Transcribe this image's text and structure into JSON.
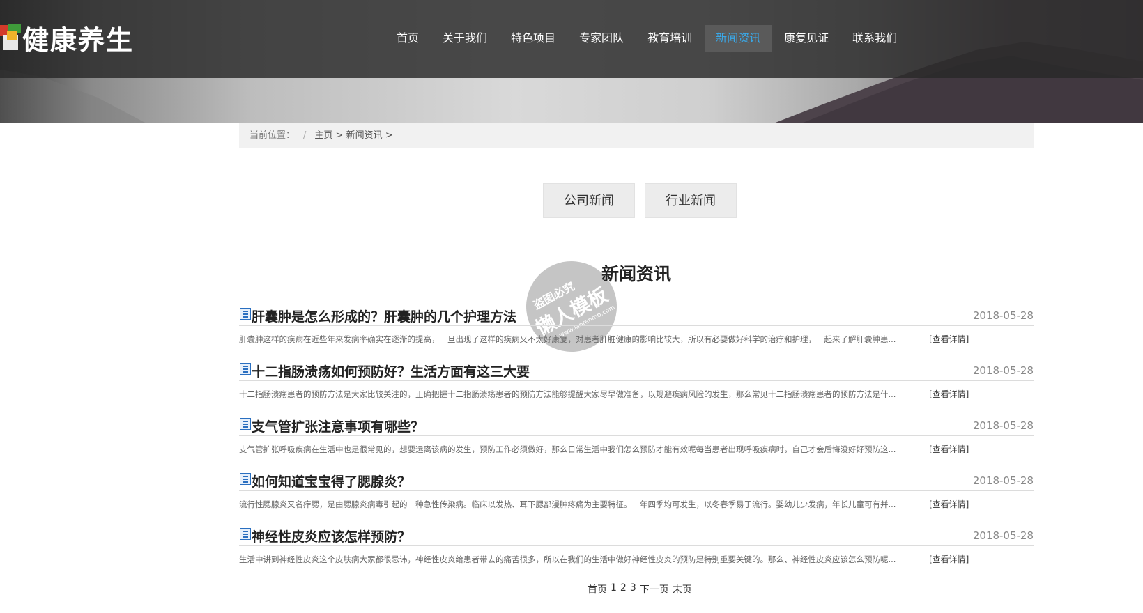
{
  "logo": {
    "text": "健康养生",
    "mark_char": "养"
  },
  "nav": {
    "items": [
      {
        "label": "首页"
      },
      {
        "label": "关于我们"
      },
      {
        "label": "特色项目"
      },
      {
        "label": "专家团队"
      },
      {
        "label": "教育培训"
      },
      {
        "label": "新闻资讯",
        "active": true
      },
      {
        "label": "康复见证"
      },
      {
        "label": "联系我们"
      }
    ],
    "active_color": "#3aa8e8"
  },
  "breadcrumb": {
    "prefix": "当前位置：",
    "divider": "/",
    "path": "主页 > 新闻资讯 >"
  },
  "tabs": [
    {
      "label": "公司新闻"
    },
    {
      "label": "行业新闻"
    }
  ],
  "section_title": "新闻资讯",
  "watermark": {
    "line1": "盗图必究",
    "line2": "懒人模板",
    "line3": "www.lanrenmb.com"
  },
  "news": [
    {
      "title": "肝囊肿是怎么形成的？肝囊肿的几个护理方法",
      "date": "2018-05-28",
      "summary": "肝囊肿这样的疾病在近些年来发病率确实在逐渐的提高，一旦出现了这样的疾病又不太好康复，对患者肝脏健康的影响比较大，所以有必要做好科学的治疗和护理，一起来了解肝囊肿患...",
      "more": "[查看详情]"
    },
    {
      "title": "十二指肠溃疡如何预防好？生活方面有这三大要",
      "date": "2018-05-28",
      "summary": "十二指肠溃疡患者的预防方法是大家比较关注的，正确把握十二指肠溃疡患者的预防方法能够提醒大家尽早做准备，以规避疾病风险的发生，那么常见十二指肠溃疡患者的预防方法是什...",
      "more": "[查看详情]"
    },
    {
      "title": "支气管扩张注意事项有哪些？",
      "date": "2018-05-28",
      "summary": "支气管扩张呼吸疾病在生活中也是很常见的，想要远离该病的发生，预防工作必须做好，那么日常生活中我们怎么预防才能有效呢每当患者出现呼吸疾病时，自己才会后悔没好好预防这...",
      "more": "[查看详情]"
    },
    {
      "title": "如何知道宝宝得了腮腺炎？",
      "date": "2018-05-28",
      "summary": "流行性腮腺炎又名痄腮，是由腮腺炎病毒引起的一种急性传染病。临床以发热、耳下腮部漫肿疼痛为主要特征。一年四季均可发生，以冬春季易于流行。婴幼儿少发病，年长儿童可有并...",
      "more": "[查看详情]"
    },
    {
      "title": "神经性皮炎应该怎样预防？",
      "date": "2018-05-28",
      "summary": "生活中讲到神经性皮炎这个皮肤病大家都很忌讳，神经性皮炎给患者带去的痛苦很多，所以在我们的生活中做好神经性皮炎的预防是特别重要关键的。那么、神经性皮炎应该怎么预防呢...",
      "more": "[查看详情]"
    }
  ],
  "pagination": {
    "first": "首页",
    "pages": [
      "1",
      "2",
      "3"
    ],
    "next": "下一页",
    "last": "末页"
  }
}
